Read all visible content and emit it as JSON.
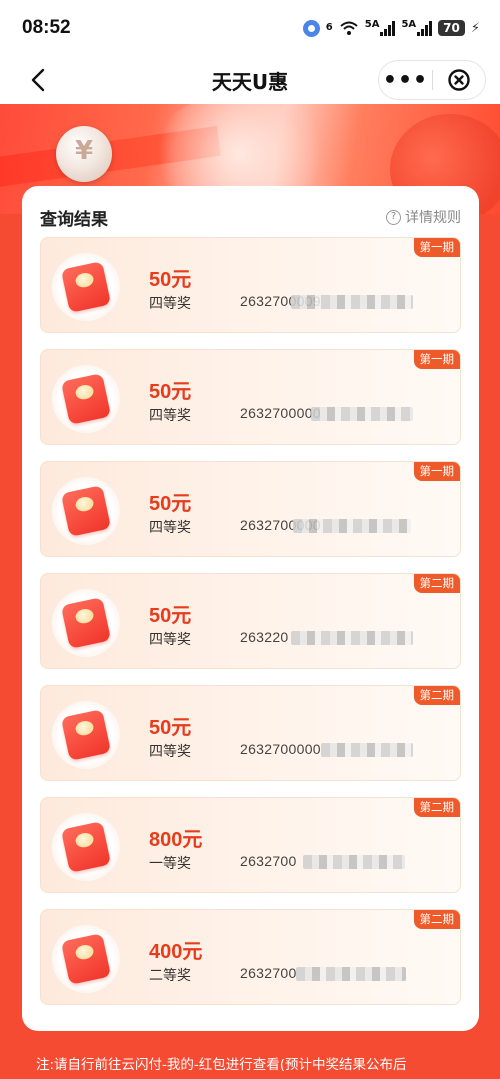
{
  "status_bar": {
    "time": "08:52",
    "network_a": "6",
    "network_b": "5A",
    "network_c": "5A",
    "battery": "70"
  },
  "nav": {
    "title": "天天U惠",
    "more_label": "•••"
  },
  "card": {
    "title": "查询结果",
    "rules_label": "详情规则"
  },
  "results": [
    {
      "amount": "50元",
      "level": "四等奖",
      "serial": "2632700009",
      "period": "第一期"
    },
    {
      "amount": "50元",
      "level": "四等奖",
      "serial": "2632700000",
      "period": "第一期"
    },
    {
      "amount": "50元",
      "level": "四等奖",
      "serial": "2632700000",
      "period": "第一期"
    },
    {
      "amount": "50元",
      "level": "四等奖",
      "serial": "263220",
      "period": "第二期"
    },
    {
      "amount": "50元",
      "level": "四等奖",
      "serial": "2632700000",
      "period": "第二期"
    },
    {
      "amount": "800元",
      "level": "一等奖",
      "serial": "2632700",
      "period": "第二期"
    },
    {
      "amount": "400元",
      "level": "二等奖",
      "serial": "2632700",
      "period": "第二期"
    }
  ],
  "footer": {
    "note": "注:请自行前往云闪付-我的-红包进行查看(预计中奖结果公布后"
  },
  "colors": {
    "accent": "#e63c1e",
    "period_tag": "#ef5a2a",
    "background": "#f44b32"
  }
}
